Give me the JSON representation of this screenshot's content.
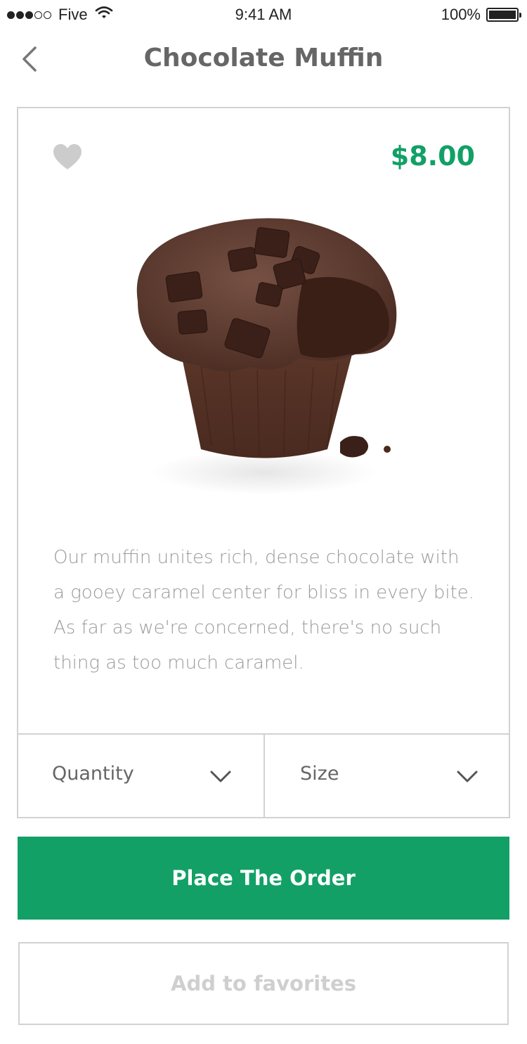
{
  "status_bar": {
    "carrier": "Five",
    "time": "9:41 AM",
    "battery": "100%",
    "signal_strength": 3,
    "signal_max": 5,
    "battery_level": 1.0
  },
  "nav": {
    "title": "Chocolate Muffin",
    "back_icon": "chevron-left-icon"
  },
  "product": {
    "price": "$8.00",
    "favorite_icon": "heart-icon",
    "image": "chocolate-muffin-photo",
    "description": [
      "Our muffin unites rich, dense chocolate with",
      "a gooey caramel center for bliss in every bite.",
      "As far as we're concerned, there's no such",
      "thing as too much caramel."
    ]
  },
  "selectors": {
    "quantity_label": "Quantity",
    "size_label": "Size"
  },
  "actions": {
    "order_label": "Place The Order",
    "favorites_label": "Add to favorites"
  },
  "colors": {
    "accent": "#12a066",
    "text": "#666666",
    "muted_text": "#9a9a9a",
    "border": "#d2d2d2",
    "disabled_text": "#cfcfcf"
  }
}
